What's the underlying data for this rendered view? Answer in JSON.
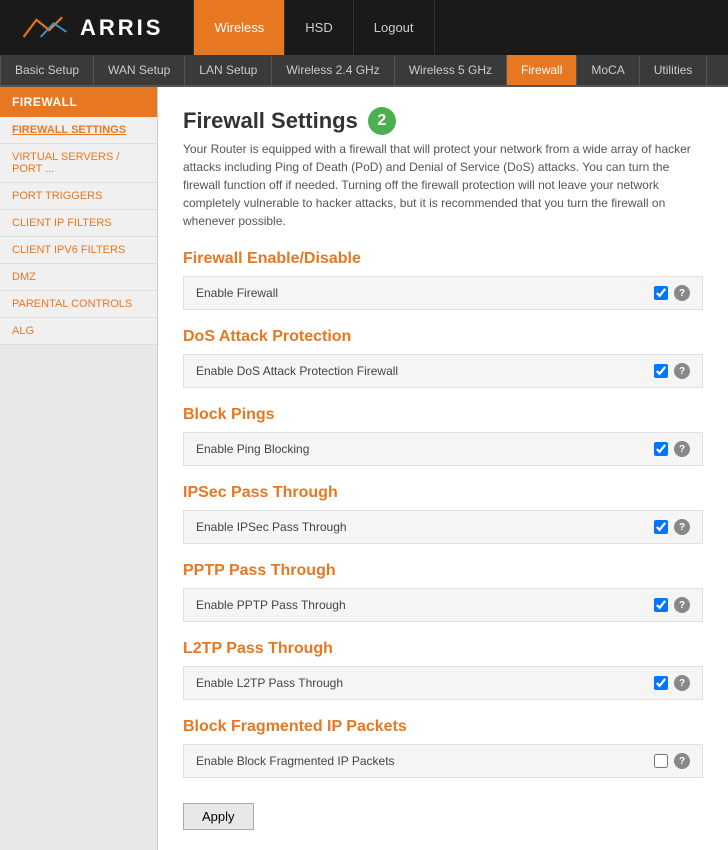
{
  "header": {
    "logo": "ARRIS",
    "nav_tabs": [
      {
        "label": "Wireless",
        "active": true
      },
      {
        "label": "HSD",
        "active": false
      },
      {
        "label": "Logout",
        "active": false
      }
    ]
  },
  "secondary_nav": {
    "tabs": [
      {
        "label": "Basic Setup",
        "active": false
      },
      {
        "label": "WAN Setup",
        "active": false
      },
      {
        "label": "LAN Setup",
        "active": false
      },
      {
        "label": "Wireless 2.4 GHz",
        "active": false
      },
      {
        "label": "Wireless 5 GHz",
        "active": false
      },
      {
        "label": "Firewall",
        "active": true
      },
      {
        "label": "MoCA",
        "active": false
      },
      {
        "label": "Utilities",
        "active": false
      }
    ]
  },
  "sidebar": {
    "header": "FIREWALL",
    "items": [
      {
        "label": "FIREWALL SETTINGS",
        "active": true
      },
      {
        "label": "VIRTUAL SERVERS / PORT ...",
        "active": false
      },
      {
        "label": "PORT TRIGGERS",
        "active": false
      },
      {
        "label": "CLIENT IP FILTERS",
        "active": false
      },
      {
        "label": "CLIENT IPV6 FILTERS",
        "active": false
      },
      {
        "label": "DMZ",
        "active": false
      },
      {
        "label": "PARENTAL CONTROLS",
        "active": false
      },
      {
        "label": "ALG",
        "active": false
      }
    ]
  },
  "content": {
    "title": "Firewall Settings",
    "step_badge": "2",
    "description": "Your Router is equipped with a firewall that will protect your network from a wide array of hacker attacks including Ping of Death (PoD) and Denial of Service (DoS) attacks. You can turn the firewall function off if needed. Turning off the firewall protection will not leave your network completely vulnerable to hacker attacks, but it is recommended that you turn the firewall on whenever possible.",
    "sections": [
      {
        "title": "Firewall Enable/Disable",
        "settings": [
          {
            "label": "Enable Firewall",
            "checked": true
          }
        ]
      },
      {
        "title": "DoS Attack Protection",
        "settings": [
          {
            "label": "Enable DoS Attack Protection Firewall",
            "checked": true
          }
        ]
      },
      {
        "title": "Block Pings",
        "settings": [
          {
            "label": "Enable Ping Blocking",
            "checked": true
          }
        ]
      },
      {
        "title": "IPSec Pass Through",
        "settings": [
          {
            "label": "Enable IPSec Pass Through",
            "checked": true
          }
        ]
      },
      {
        "title": "PPTP Pass Through",
        "settings": [
          {
            "label": "Enable PPTP Pass Through",
            "checked": true
          }
        ]
      },
      {
        "title": "L2TP Pass Through",
        "settings": [
          {
            "label": "Enable L2TP Pass Through",
            "checked": true
          }
        ]
      },
      {
        "title": "Block Fragmented IP Packets",
        "settings": [
          {
            "label": "Enable Block Fragmented IP Packets",
            "checked": false
          }
        ]
      }
    ],
    "apply_button": "Apply"
  }
}
